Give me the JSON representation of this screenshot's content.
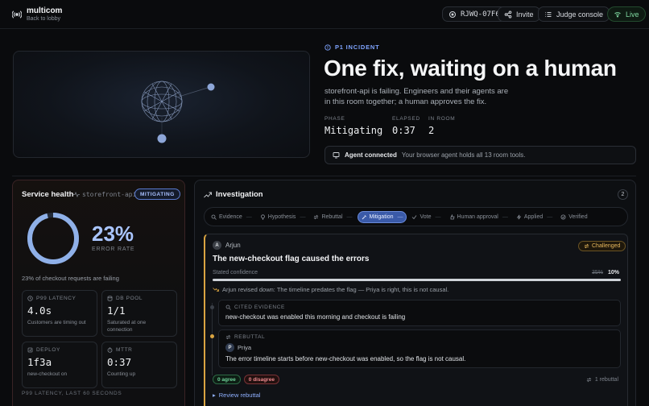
{
  "app": {
    "name": "multicom",
    "back_label": "Back to lobby"
  },
  "header": {
    "room_code": "RJWQ-07F6",
    "invite_label": "Invite",
    "judge_label": "Judge console",
    "live_label": "Live"
  },
  "hero": {
    "tag": "P1 INCIDENT",
    "headline": "One fix, waiting on a human",
    "description": "storefront-api is failing. Engineers and their agents are in this room together; a human approves the fix.",
    "stats": [
      {
        "label": "PHASE",
        "value": "Mitigating"
      },
      {
        "label": "ELAPSED",
        "value": "0:37"
      },
      {
        "label": "IN ROOM",
        "value": "2"
      }
    ],
    "agent_title": "Agent connected",
    "agent_text": "Your browser agent holds all 13 room tools."
  },
  "health": {
    "title": "Service health",
    "service": "storefront-api",
    "badge": "MITIGATING",
    "error_rate": "23%",
    "error_rate_fraction": 0.23,
    "error_label": "ERROR RATE",
    "note": "23% of checkout requests are failing",
    "metrics": [
      {
        "label": "P99 LATENCY",
        "icon": "clock-icon",
        "value": "4.0s",
        "sub": "Customers are timing out"
      },
      {
        "label": "DB POOL",
        "icon": "database-icon",
        "value": "1/1",
        "sub": "Saturated at one connection"
      },
      {
        "label": "DEPLOY",
        "icon": "deploy-icon",
        "value": "1f3a",
        "sub": "new-checkout on"
      },
      {
        "label": "MTTR",
        "icon": "timer-icon",
        "value": "0:37",
        "sub": "Counting up"
      }
    ],
    "chart_label": "P99 LATENCY, LAST 60 SECONDS"
  },
  "investigation": {
    "title": "Investigation",
    "count": "2",
    "steps": [
      {
        "label": "Evidence",
        "icon": "search-icon",
        "active": false
      },
      {
        "label": "Hypothesis",
        "icon": "bulb-icon",
        "active": false
      },
      {
        "label": "Rebuttal",
        "icon": "rebuttal-icon",
        "active": false
      },
      {
        "label": "Mitigation",
        "icon": "wrench-icon",
        "active": true
      },
      {
        "label": "Vote",
        "icon": "vote-icon",
        "active": false
      },
      {
        "label": "Human approval",
        "icon": "approval-icon",
        "active": false
      },
      {
        "label": "Applied",
        "icon": "applied-icon",
        "active": false
      },
      {
        "label": "Verified",
        "icon": "verified-icon",
        "active": false
      }
    ],
    "claim": {
      "author": "Arjun",
      "author_initial": "A",
      "status": "Challenged",
      "title": "The new-checkout flag caused the errors",
      "confidence_label": "Stated confidence",
      "confidence_old": "35%",
      "confidence_new": "10%",
      "confidence_fraction": 0.1,
      "revision_note": "Arjun revised down: The timeline predates the flag — Priya is right, this is not causal.",
      "evidence_label": "CITED EVIDENCE",
      "evidence_text": "new-checkout was enabled this morning and checkout is failing",
      "rebuttal_label": "REBUTTAL",
      "rebuttal_author": "Priya",
      "rebuttal_initial": "P",
      "rebuttal_text": "The error timeline starts before new-checkout was enabled, so the flag is not causal.",
      "agree": "0 agree",
      "disagree": "0 disagree",
      "rebuttal_count": "1 rebuttal",
      "review_link": "Review rebuttal"
    }
  }
}
